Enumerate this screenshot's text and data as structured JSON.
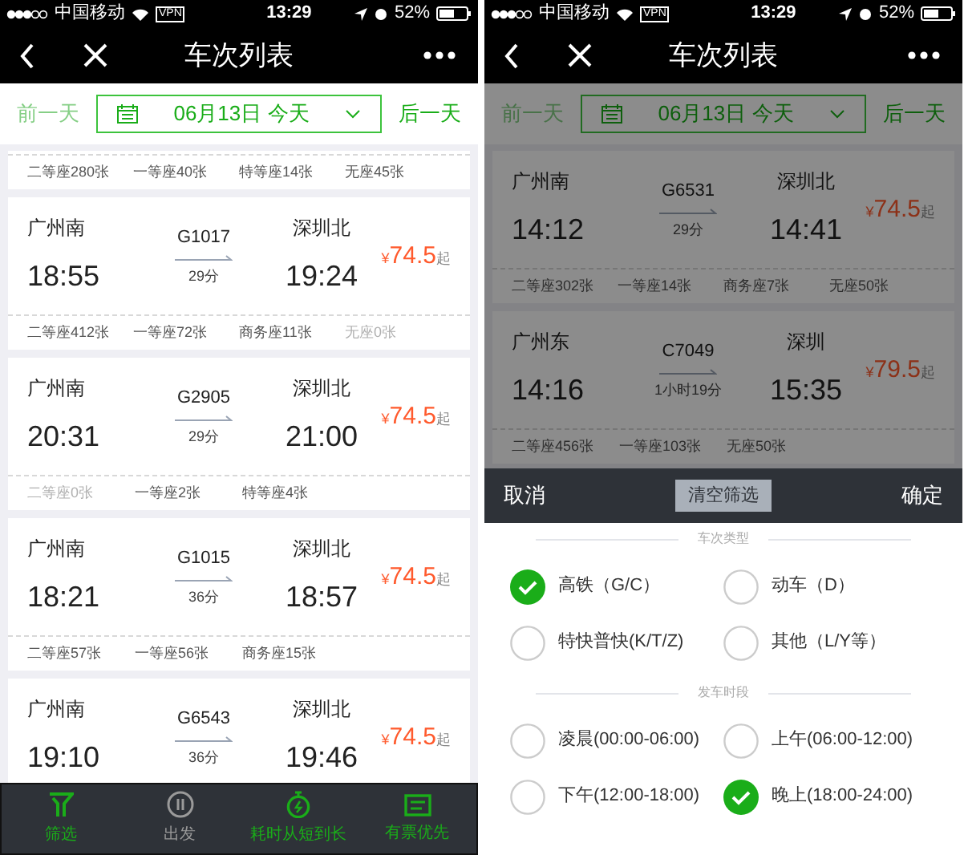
{
  "screens": [
    {
      "status_bar": {
        "carrier": "中国移动",
        "vpn": "VPN",
        "time": "13:29",
        "battery": "52%"
      },
      "nav": {
        "title": "车次列表"
      },
      "date_bar": {
        "prev": "前一天",
        "prev_disabled": true,
        "date": "06月13日 今天",
        "next": "后一天",
        "next_disabled": false
      },
      "trains": [
        {
          "kind": "seats_only",
          "seats": [
            {
              "text": "二等座280张",
              "sold_out": false
            },
            {
              "text": "一等座40张",
              "sold_out": false
            },
            {
              "text": "特等座14张",
              "sold_out": false
            },
            {
              "text": "无座45张",
              "sold_out": false
            }
          ]
        },
        {
          "kind": "full",
          "from": "广州南",
          "depart": "18:55",
          "train_no": "G1017",
          "duration": "29分",
          "to": "深圳北",
          "arrive": "19:24",
          "currency": "¥",
          "price": "74.5",
          "price_suffix": "起",
          "seats": [
            {
              "text": "二等座412张",
              "sold_out": false
            },
            {
              "text": "一等座72张",
              "sold_out": false
            },
            {
              "text": "商务座11张",
              "sold_out": false
            },
            {
              "text": "无座0张",
              "sold_out": true
            }
          ]
        },
        {
          "kind": "full",
          "from": "广州南",
          "depart": "20:31",
          "train_no": "G2905",
          "duration": "29分",
          "to": "深圳北",
          "arrive": "21:00",
          "currency": "¥",
          "price": "74.5",
          "price_suffix": "起",
          "seats": [
            {
              "text": "二等座0张",
              "sold_out": true
            },
            {
              "text": "一等座2张",
              "sold_out": false
            },
            {
              "text": "特等座4张",
              "sold_out": false
            }
          ]
        },
        {
          "kind": "full",
          "from": "广州南",
          "depart": "18:21",
          "train_no": "G1015",
          "duration": "36分",
          "to": "深圳北",
          "arrive": "18:57",
          "currency": "¥",
          "price": "74.5",
          "price_suffix": "起",
          "seats": [
            {
              "text": "二等座57张",
              "sold_out": false
            },
            {
              "text": "一等座56张",
              "sold_out": false
            },
            {
              "text": "商务座15张",
              "sold_out": false
            }
          ]
        },
        {
          "kind": "full",
          "from": "广州南",
          "depart": "19:10",
          "train_no": "G6543",
          "duration": "36分",
          "to": "深圳北",
          "arrive": "19:46",
          "currency": "¥",
          "price": "74.5",
          "price_suffix": "起"
        }
      ],
      "tab_bar": [
        {
          "kind": "filter",
          "label": "筛选",
          "selected": true
        },
        {
          "kind": "depart",
          "label": "出发",
          "selected": false
        },
        {
          "kind": "duration",
          "label": "耗时从短到长",
          "selected": true
        },
        {
          "kind": "ticket",
          "label": "有票优先",
          "selected": true
        }
      ]
    },
    {
      "status_bar": {
        "carrier": "中国移动",
        "vpn": "VPN",
        "time": "13:29",
        "battery": "52%"
      },
      "nav": {
        "title": "车次列表"
      },
      "date_bar": {
        "prev": "前一天",
        "prev_disabled": true,
        "date": "06月13日 今天",
        "next": "后一天",
        "next_disabled": false
      },
      "trains": [
        {
          "kind": "full",
          "from": "广州南",
          "depart": "14:12",
          "train_no": "G6531",
          "duration": "29分",
          "to": "深圳北",
          "arrive": "14:41",
          "currency": "¥",
          "price": "74.5",
          "price_suffix": "起",
          "seats": [
            {
              "text": "二等座302张",
              "sold_out": false
            },
            {
              "text": "一等座14张",
              "sold_out": false
            },
            {
              "text": "商务座7张",
              "sold_out": false
            },
            {
              "text": "无座50张",
              "sold_out": false
            }
          ]
        },
        {
          "kind": "full",
          "from": "广州东",
          "depart": "14:16",
          "train_no": "C7049",
          "duration": "1小时19分",
          "to": "深圳",
          "arrive": "15:35",
          "currency": "¥",
          "price": "79.5",
          "price_suffix": "起",
          "seats": [
            {
              "text": "二等座456张",
              "sold_out": false
            },
            {
              "text": "一等座103张",
              "sold_out": false
            },
            {
              "text": "无座50张",
              "sold_out": false
            }
          ]
        }
      ],
      "filter": {
        "cancel": "取消",
        "clear": "清空筛选",
        "confirm": "确定",
        "sections": [
          {
            "title": "车次类型",
            "options": [
              {
                "label": "高铁（G/C）",
                "selected": true
              },
              {
                "label": "动车（D）",
                "selected": false
              },
              {
                "label": "特快普快(K/T/Z)",
                "selected": false
              },
              {
                "label": "其他（L/Y等）",
                "selected": false
              }
            ]
          },
          {
            "title": "发车时段",
            "options": [
              {
                "label": "凌晨(00:00-06:00)",
                "selected": false
              },
              {
                "label": "上午(06:00-12:00)",
                "selected": false
              },
              {
                "label": "下午(12:00-18:00)",
                "selected": false
              },
              {
                "label": "晚上(18:00-24:00)",
                "selected": true
              }
            ]
          }
        ]
      }
    }
  ]
}
